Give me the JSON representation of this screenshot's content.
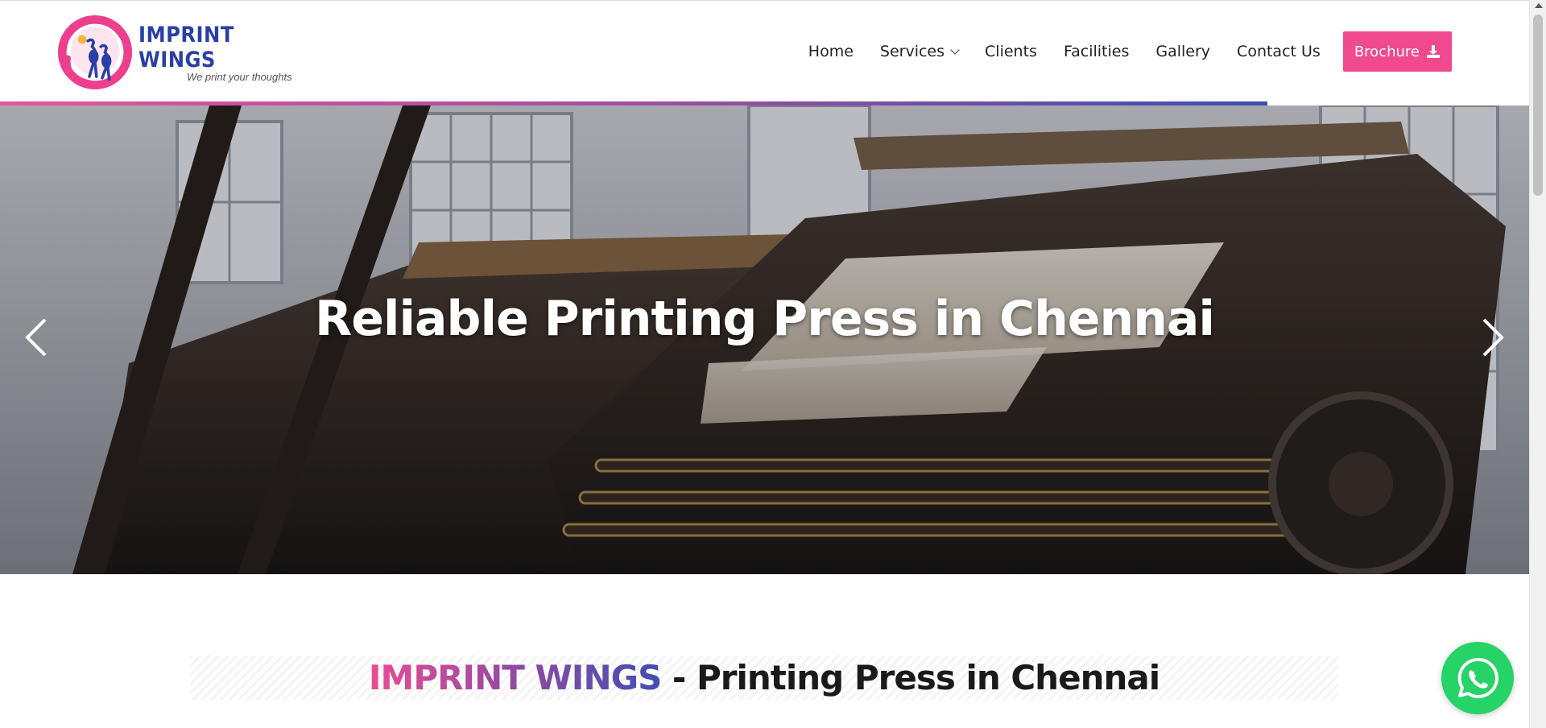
{
  "brand": {
    "name": "IMPRINT WINGS",
    "tagline": "We print your thoughts",
    "colors": {
      "pink": "#f0498e",
      "blue": "#2a3fa6",
      "purple": "#8a4aa5"
    }
  },
  "nav": {
    "items": [
      {
        "label": "Home"
      },
      {
        "label": "Services",
        "has_dropdown": true
      },
      {
        "label": "Clients"
      },
      {
        "label": "Facilities"
      },
      {
        "label": "Gallery"
      },
      {
        "label": "Contact Us"
      }
    ],
    "brochure_label": "Brochure",
    "brochure_icon": "download-icon"
  },
  "hero": {
    "title": "Reliable Printing Press in Chennai",
    "prev_icon": "chevron-left-icon",
    "next_icon": "chevron-right-icon"
  },
  "section": {
    "brand_part": "IMPRINT WINGS",
    "rest": " - Printing Press in Chennai"
  },
  "whatsapp": {
    "icon": "whatsapp-icon",
    "color": "#25d366"
  }
}
